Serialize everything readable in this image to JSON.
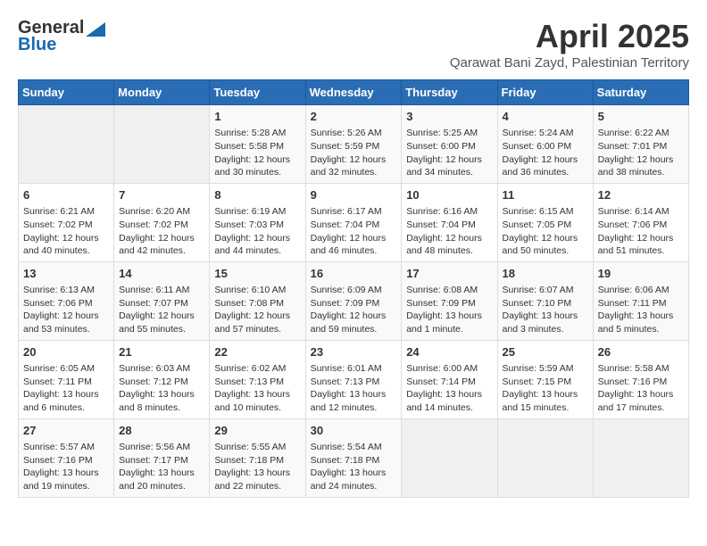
{
  "logo": {
    "general": "General",
    "blue": "Blue"
  },
  "title": {
    "month": "April 2025",
    "location": "Qarawat Bani Zayd, Palestinian Territory"
  },
  "headers": [
    "Sunday",
    "Monday",
    "Tuesday",
    "Wednesday",
    "Thursday",
    "Friday",
    "Saturday"
  ],
  "weeks": [
    [
      {
        "day": "",
        "sunrise": "",
        "sunset": "",
        "daylight": ""
      },
      {
        "day": "",
        "sunrise": "",
        "sunset": "",
        "daylight": ""
      },
      {
        "day": "1",
        "sunrise": "Sunrise: 5:28 AM",
        "sunset": "Sunset: 5:58 PM",
        "daylight": "Daylight: 12 hours and 30 minutes."
      },
      {
        "day": "2",
        "sunrise": "Sunrise: 5:26 AM",
        "sunset": "Sunset: 5:59 PM",
        "daylight": "Daylight: 12 hours and 32 minutes."
      },
      {
        "day": "3",
        "sunrise": "Sunrise: 5:25 AM",
        "sunset": "Sunset: 6:00 PM",
        "daylight": "Daylight: 12 hours and 34 minutes."
      },
      {
        "day": "4",
        "sunrise": "Sunrise: 5:24 AM",
        "sunset": "Sunset: 6:00 PM",
        "daylight": "Daylight: 12 hours and 36 minutes."
      },
      {
        "day": "5",
        "sunrise": "Sunrise: 6:22 AM",
        "sunset": "Sunset: 7:01 PM",
        "daylight": "Daylight: 12 hours and 38 minutes."
      }
    ],
    [
      {
        "day": "6",
        "sunrise": "Sunrise: 6:21 AM",
        "sunset": "Sunset: 7:02 PM",
        "daylight": "Daylight: 12 hours and 40 minutes."
      },
      {
        "day": "7",
        "sunrise": "Sunrise: 6:20 AM",
        "sunset": "Sunset: 7:02 PM",
        "daylight": "Daylight: 12 hours and 42 minutes."
      },
      {
        "day": "8",
        "sunrise": "Sunrise: 6:19 AM",
        "sunset": "Sunset: 7:03 PM",
        "daylight": "Daylight: 12 hours and 44 minutes."
      },
      {
        "day": "9",
        "sunrise": "Sunrise: 6:17 AM",
        "sunset": "Sunset: 7:04 PM",
        "daylight": "Daylight: 12 hours and 46 minutes."
      },
      {
        "day": "10",
        "sunrise": "Sunrise: 6:16 AM",
        "sunset": "Sunset: 7:04 PM",
        "daylight": "Daylight: 12 hours and 48 minutes."
      },
      {
        "day": "11",
        "sunrise": "Sunrise: 6:15 AM",
        "sunset": "Sunset: 7:05 PM",
        "daylight": "Daylight: 12 hours and 50 minutes."
      },
      {
        "day": "12",
        "sunrise": "Sunrise: 6:14 AM",
        "sunset": "Sunset: 7:06 PM",
        "daylight": "Daylight: 12 hours and 51 minutes."
      }
    ],
    [
      {
        "day": "13",
        "sunrise": "Sunrise: 6:13 AM",
        "sunset": "Sunset: 7:06 PM",
        "daylight": "Daylight: 12 hours and 53 minutes."
      },
      {
        "day": "14",
        "sunrise": "Sunrise: 6:11 AM",
        "sunset": "Sunset: 7:07 PM",
        "daylight": "Daylight: 12 hours and 55 minutes."
      },
      {
        "day": "15",
        "sunrise": "Sunrise: 6:10 AM",
        "sunset": "Sunset: 7:08 PM",
        "daylight": "Daylight: 12 hours and 57 minutes."
      },
      {
        "day": "16",
        "sunrise": "Sunrise: 6:09 AM",
        "sunset": "Sunset: 7:09 PM",
        "daylight": "Daylight: 12 hours and 59 minutes."
      },
      {
        "day": "17",
        "sunrise": "Sunrise: 6:08 AM",
        "sunset": "Sunset: 7:09 PM",
        "daylight": "Daylight: 13 hours and 1 minute."
      },
      {
        "day": "18",
        "sunrise": "Sunrise: 6:07 AM",
        "sunset": "Sunset: 7:10 PM",
        "daylight": "Daylight: 13 hours and 3 minutes."
      },
      {
        "day": "19",
        "sunrise": "Sunrise: 6:06 AM",
        "sunset": "Sunset: 7:11 PM",
        "daylight": "Daylight: 13 hours and 5 minutes."
      }
    ],
    [
      {
        "day": "20",
        "sunrise": "Sunrise: 6:05 AM",
        "sunset": "Sunset: 7:11 PM",
        "daylight": "Daylight: 13 hours and 6 minutes."
      },
      {
        "day": "21",
        "sunrise": "Sunrise: 6:03 AM",
        "sunset": "Sunset: 7:12 PM",
        "daylight": "Daylight: 13 hours and 8 minutes."
      },
      {
        "day": "22",
        "sunrise": "Sunrise: 6:02 AM",
        "sunset": "Sunset: 7:13 PM",
        "daylight": "Daylight: 13 hours and 10 minutes."
      },
      {
        "day": "23",
        "sunrise": "Sunrise: 6:01 AM",
        "sunset": "Sunset: 7:13 PM",
        "daylight": "Daylight: 13 hours and 12 minutes."
      },
      {
        "day": "24",
        "sunrise": "Sunrise: 6:00 AM",
        "sunset": "Sunset: 7:14 PM",
        "daylight": "Daylight: 13 hours and 14 minutes."
      },
      {
        "day": "25",
        "sunrise": "Sunrise: 5:59 AM",
        "sunset": "Sunset: 7:15 PM",
        "daylight": "Daylight: 13 hours and 15 minutes."
      },
      {
        "day": "26",
        "sunrise": "Sunrise: 5:58 AM",
        "sunset": "Sunset: 7:16 PM",
        "daylight": "Daylight: 13 hours and 17 minutes."
      }
    ],
    [
      {
        "day": "27",
        "sunrise": "Sunrise: 5:57 AM",
        "sunset": "Sunset: 7:16 PM",
        "daylight": "Daylight: 13 hours and 19 minutes."
      },
      {
        "day": "28",
        "sunrise": "Sunrise: 5:56 AM",
        "sunset": "Sunset: 7:17 PM",
        "daylight": "Daylight: 13 hours and 20 minutes."
      },
      {
        "day": "29",
        "sunrise": "Sunrise: 5:55 AM",
        "sunset": "Sunset: 7:18 PM",
        "daylight": "Daylight: 13 hours and 22 minutes."
      },
      {
        "day": "30",
        "sunrise": "Sunrise: 5:54 AM",
        "sunset": "Sunset: 7:18 PM",
        "daylight": "Daylight: 13 hours and 24 minutes."
      },
      {
        "day": "",
        "sunrise": "",
        "sunset": "",
        "daylight": ""
      },
      {
        "day": "",
        "sunrise": "",
        "sunset": "",
        "daylight": ""
      },
      {
        "day": "",
        "sunrise": "",
        "sunset": "",
        "daylight": ""
      }
    ]
  ]
}
